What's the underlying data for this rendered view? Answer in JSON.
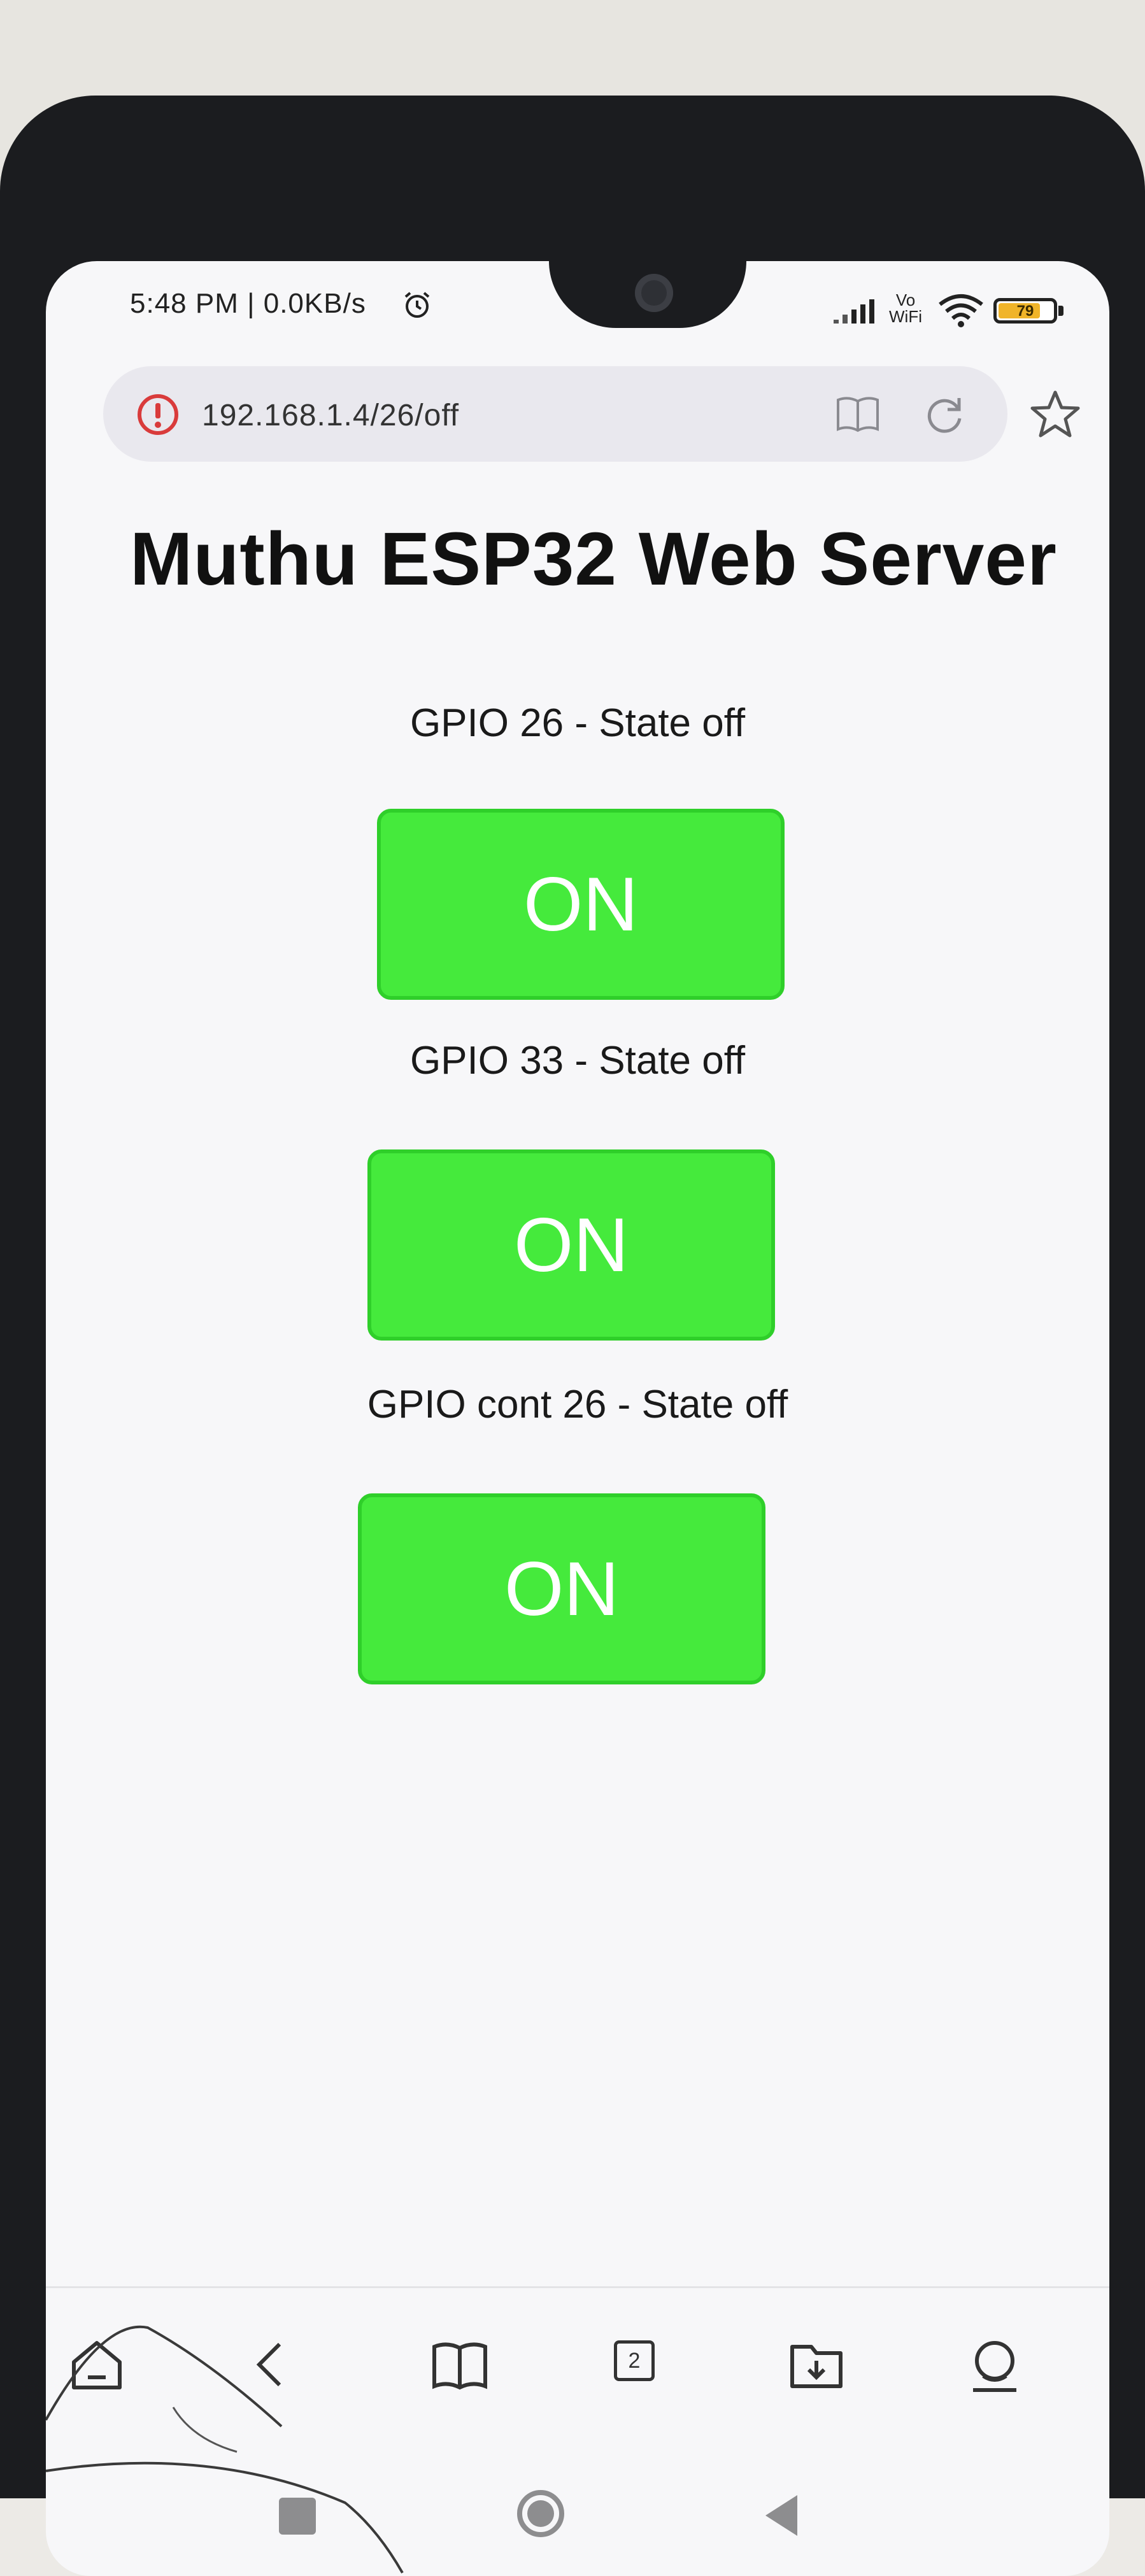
{
  "status_bar": {
    "time_speed": "5:48 PM | 0.0KB/s",
    "network_label": "Vo\nWiFi",
    "battery_percent": "79",
    "battery_level": 0.79,
    "icons": [
      "alarm-icon",
      "signal-icon",
      "wifi-icon",
      "battery-icon"
    ]
  },
  "browser": {
    "url": "192.168.1.4/26/off",
    "icons": [
      "warning-icon",
      "reader-mode-icon",
      "reload-icon",
      "bookmark-star-icon"
    ]
  },
  "page": {
    "title": "Muthu ESP32 Web Server",
    "controls": [
      {
        "label": "GPIO 26 - State off",
        "button": "ON"
      },
      {
        "label": "GPIO 33 - State off",
        "button": "ON"
      },
      {
        "label": "GPIO cont 26 - State off",
        "button": "ON"
      }
    ]
  },
  "bottom_nav": {
    "tab_count": "2",
    "icons": [
      "home-icon",
      "back-icon",
      "bookmarks-icon",
      "tabs-icon",
      "downloads-icon",
      "profile-icon"
    ]
  },
  "system_nav": {
    "icons": [
      "recents-icon",
      "home-button-icon",
      "back-button-icon"
    ]
  },
  "colors": {
    "button_green": "#45ea3c",
    "button_border": "#2fcf2a",
    "screen_bg": "#f7f7f9",
    "warning_red": "#d93b3b"
  }
}
